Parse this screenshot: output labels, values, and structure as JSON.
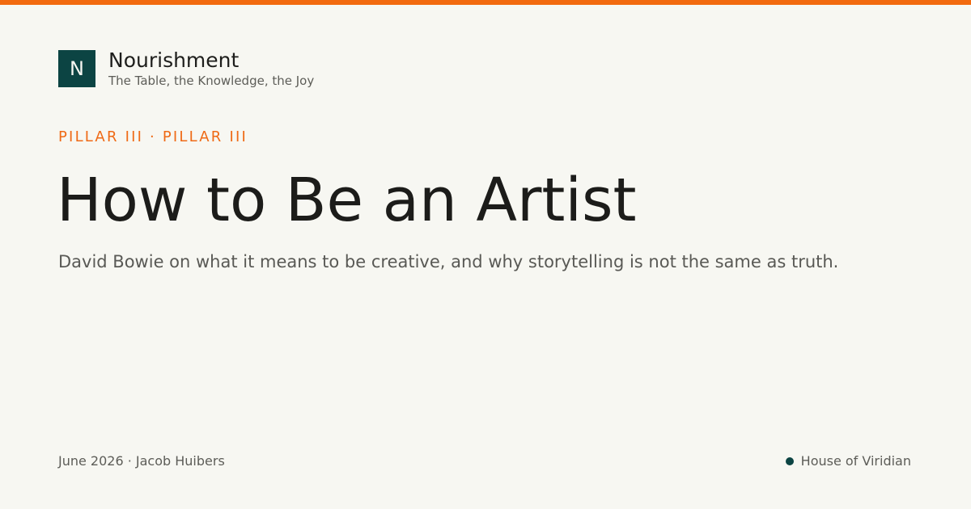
{
  "brand": {
    "logo_letter": "N",
    "name": "Nourishment",
    "tagline": "The Table, the Knowledge, the Joy"
  },
  "article": {
    "eyebrow": "PILLAR III · PILLAR III",
    "title": "How to Be an Artist",
    "subtitle": "David Bowie on what it means to be creative, and why storytelling is not the same as truth."
  },
  "footer": {
    "byline": "June 2026 · Jacob Huibers",
    "publisher": "House of Viridian"
  },
  "colors": {
    "accent": "#f26a0f",
    "brand": "#0c4443",
    "background": "#f7f7f2"
  }
}
